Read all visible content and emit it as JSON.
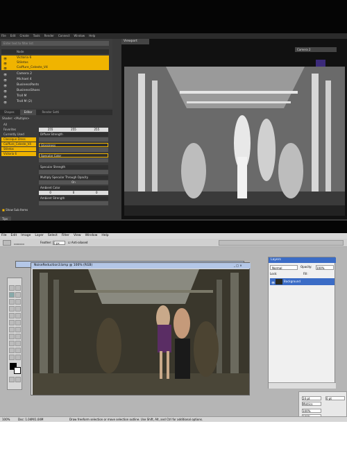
{
  "daz": {
    "menu": [
      "File",
      "Edit",
      "Create",
      "Tools",
      "Render",
      "Connect",
      "Window",
      "Help"
    ],
    "scene_filter_placeholder": "Enter text to filter list",
    "scene_header": "Node",
    "scene_items": [
      {
        "label": "Victoria 6",
        "selected": true
      },
      {
        "label": "Stiletos",
        "selected": true
      },
      {
        "label": "Coiffure_Celeste_V4",
        "selected": true
      },
      {
        "label": "Camera 2",
        "selected": false
      },
      {
        "label": "Michael 4",
        "selected": false
      },
      {
        "label": "BusinessPants",
        "selected": false
      },
      {
        "label": "BusinessShoes",
        "selected": false
      },
      {
        "label": "Troll M",
        "selected": false
      },
      {
        "label": "Troll M (2)",
        "selected": false
      }
    ],
    "tabs": [
      "Shapes",
      "Editor",
      "Render Setti"
    ],
    "shader_label": "Shader: <Multiple>",
    "surface_filters": [
      "All",
      "Favorites",
      "Currently Used"
    ],
    "surfaces": [
      {
        "label": "Classique Dress",
        "selected": true
      },
      {
        "label": "Coiffure_Celeste_V4",
        "selected": true
      },
      {
        "label": "Stiletos",
        "selected": true
      },
      {
        "label": "Victoria 6",
        "selected": true
      }
    ],
    "properties": [
      "Diffuse Strength",
      "Glossiness",
      "Specular Color",
      "Specular Strength",
      "Multiply Specular Through Opacity",
      "Ambient Color",
      "Ambient Strength"
    ],
    "diffuse_values": [
      "255",
      "255",
      "255"
    ],
    "ambient_values": [
      "0",
      "0",
      "0"
    ],
    "toggle_value": "On",
    "show_sub_items": "Show Sub Items",
    "tips_label": "Tips",
    "viewport_tab": "Viewport",
    "camera_select": "Camera 2",
    "aspect": "16 : 9"
  },
  "ps": {
    "menu": [
      "File",
      "Edit",
      "Image",
      "Layer",
      "Select",
      "Filter",
      "View",
      "Window",
      "Help"
    ],
    "feather_label": "Feather:",
    "feather_value": "0 px",
    "antialiased": "Anti-aliased",
    "doc_title": "NoiseReduction3.bmp @ 100% (RGB)",
    "layers_title": "Layers",
    "blend_mode": "Normal",
    "opacity_label": "Opacity:",
    "opacity_value": "100%",
    "lock_label": "Lock:",
    "fill_label": "Fill:",
    "layer_name": "Background",
    "zoom": "100%",
    "doc_size": "Doc: 1.04M/1.04M",
    "status_hint": "Draw freeform selection or move selection outline. Use Shift, Alt, and Ctrl for additional options.",
    "char_font_size": "24 pt",
    "char_metrics": "Metrics",
    "char_leading": "0 pt",
    "char_scale_v": "100%",
    "char_scale_h": "100%",
    "char_color_label": "Color:"
  }
}
